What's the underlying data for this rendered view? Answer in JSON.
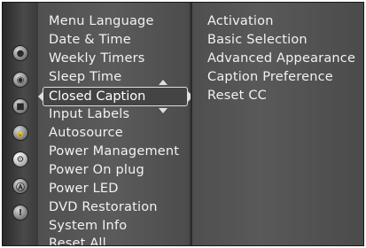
{
  "rail": {
    "icons": [
      {
        "name": "picture-icon",
        "glyph": "●"
      },
      {
        "name": "sound-icon",
        "glyph": "◉"
      },
      {
        "name": "channel-icon",
        "glyph": "■"
      },
      {
        "name": "lock-icon",
        "glyph": "🔒"
      },
      {
        "name": "setup-icon",
        "glyph": "⚙"
      },
      {
        "name": "application-icon",
        "glyph": "Ⓐ"
      },
      {
        "name": "info-icon",
        "glyph": "!"
      }
    ],
    "active_index": 4
  },
  "menu": {
    "items": [
      "Menu Language",
      "Date & Time",
      "Weekly Timers",
      "Sleep Time",
      "Closed Caption",
      "Input Labels",
      "Autosource",
      "Power Management",
      "Power On plug",
      "Power LED",
      "DVD Restoration",
      "System Info",
      "Reset All"
    ],
    "selected_index": 4
  },
  "submenu": {
    "items": [
      "Activation",
      "Basic Selection",
      "Advanced Appearance",
      "Caption Preference",
      "Reset CC"
    ]
  }
}
